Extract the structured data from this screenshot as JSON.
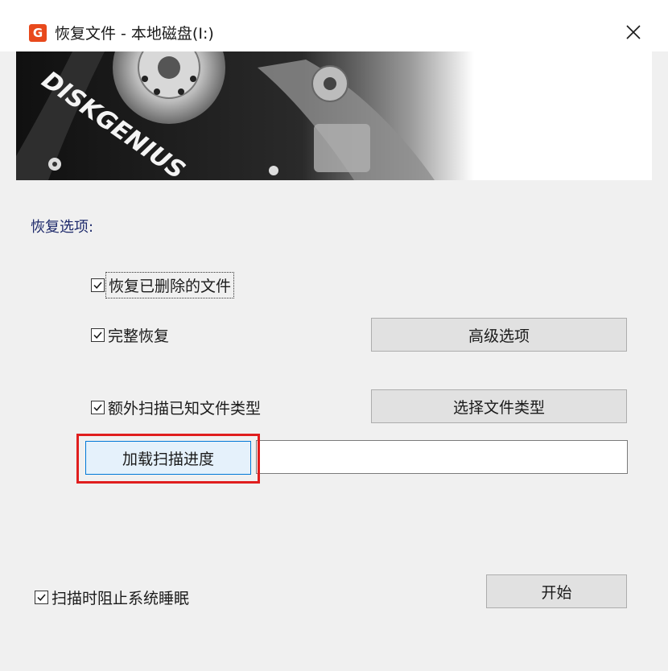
{
  "window": {
    "title": "恢复文件 - 本地磁盘(I:)",
    "app_icon_glyph": "G"
  },
  "banner": {
    "brand_text": "DISKGENIUS"
  },
  "options": {
    "group_label": "恢复选项:",
    "recover_deleted": {
      "label": "恢复已删除的文件",
      "checked": true
    },
    "full_recovery": {
      "label": "完整恢复",
      "checked": true
    },
    "scan_known_types": {
      "label": "额外扫描已知文件类型",
      "checked": true
    }
  },
  "buttons": {
    "advanced": "高级选项",
    "select_types": "选择文件类型",
    "load_progress": "加载扫描进度",
    "start": "开始"
  },
  "load_progress_path": "",
  "prevent_sleep": {
    "label": "扫描时阻止系统睡眠",
    "checked": true
  },
  "colors": {
    "app_icon": "#e8491c",
    "highlight": "#e01e1e",
    "default_button_border": "#0078d7",
    "group_label": "#1e2a6b"
  }
}
